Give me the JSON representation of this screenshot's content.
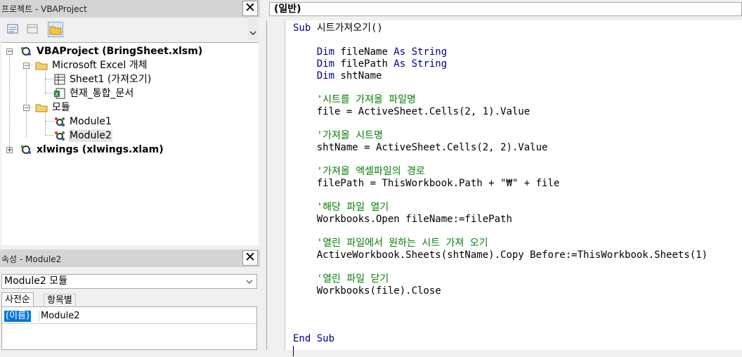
{
  "project_pane": {
    "title": "프로젝트 - VBAProject",
    "close": "✕",
    "tree": [
      {
        "label": "VBAProject (BringSheet.xlsm)",
        "bold": true
      },
      {
        "label": "Microsoft Excel 개체"
      },
      {
        "label": "Sheet1 (가져오기)"
      },
      {
        "label": "현재_통합_문서"
      },
      {
        "label": "모듈"
      },
      {
        "label": "Module1"
      },
      {
        "label": "Module2"
      },
      {
        "label": "xlwings (xlwings.xlam)",
        "bold": true
      }
    ]
  },
  "props_pane": {
    "title": "속성 - Module2",
    "close": "✕",
    "object_select": "Module2 모듈",
    "tabs": [
      "사전순",
      "항목별"
    ],
    "row": {
      "key": "(이름)",
      "value": "Module2"
    }
  },
  "code_window": {
    "proc_select": "(일반)",
    "lines": [
      {
        "indent": 0,
        "parts": [
          {
            "t": "Sub ",
            "k": 1
          },
          {
            "t": "시트가져오기()"
          }
        ]
      },
      {
        "indent": 0,
        "parts": []
      },
      {
        "indent": 1,
        "parts": [
          {
            "t": "Dim ",
            "k": 1
          },
          {
            "t": "fileName "
          },
          {
            "t": "As String",
            "k": 1
          }
        ]
      },
      {
        "indent": 1,
        "parts": [
          {
            "t": "Dim ",
            "k": 1
          },
          {
            "t": "filePath "
          },
          {
            "t": "As String",
            "k": 1
          }
        ]
      },
      {
        "indent": 1,
        "parts": [
          {
            "t": "Dim ",
            "k": 1
          },
          {
            "t": "shtName"
          }
        ]
      },
      {
        "indent": 0,
        "parts": []
      },
      {
        "indent": 1,
        "parts": [
          {
            "t": "'시트를 가져올 파일명",
            "c": 1
          }
        ]
      },
      {
        "indent": 1,
        "parts": [
          {
            "t": "file = ActiveSheet.Cells(2, 1).Value"
          }
        ]
      },
      {
        "indent": 0,
        "parts": []
      },
      {
        "indent": 1,
        "parts": [
          {
            "t": "'가져올 시트명",
            "c": 1
          }
        ]
      },
      {
        "indent": 1,
        "parts": [
          {
            "t": "shtName = ActiveSheet.Cells(2, 2).Value"
          }
        ]
      },
      {
        "indent": 0,
        "parts": []
      },
      {
        "indent": 1,
        "parts": [
          {
            "t": "'가져올 엑셀파일의 경로",
            "c": 1
          }
        ]
      },
      {
        "indent": 1,
        "parts": [
          {
            "t": "filePath = ThisWorkbook.Path + \"₩\" + file"
          }
        ]
      },
      {
        "indent": 0,
        "parts": []
      },
      {
        "indent": 1,
        "parts": [
          {
            "t": "'해당 파일 열기",
            "c": 1
          }
        ]
      },
      {
        "indent": 1,
        "parts": [
          {
            "t": "Workbooks.Open fileName:=filePath"
          }
        ]
      },
      {
        "indent": 0,
        "parts": []
      },
      {
        "indent": 1,
        "parts": [
          {
            "t": "'열린 파일에서 원하는 시트 가져 오기",
            "c": 1
          }
        ]
      },
      {
        "indent": 1,
        "parts": [
          {
            "t": "ActiveWorkbook.Sheets(shtName).Copy Before:=ThisWorkbook.Sheets(1)"
          }
        ]
      },
      {
        "indent": 0,
        "parts": []
      },
      {
        "indent": 1,
        "parts": [
          {
            "t": "'열린 파일 닫기",
            "c": 1
          }
        ]
      },
      {
        "indent": 1,
        "parts": [
          {
            "t": "Workbooks(file).Close"
          }
        ]
      },
      {
        "indent": 0,
        "parts": []
      },
      {
        "indent": 0,
        "parts": []
      },
      {
        "indent": 0,
        "parts": []
      },
      {
        "indent": 0,
        "parts": [
          {
            "t": "End Sub",
            "k": 1
          }
        ]
      }
    ]
  }
}
